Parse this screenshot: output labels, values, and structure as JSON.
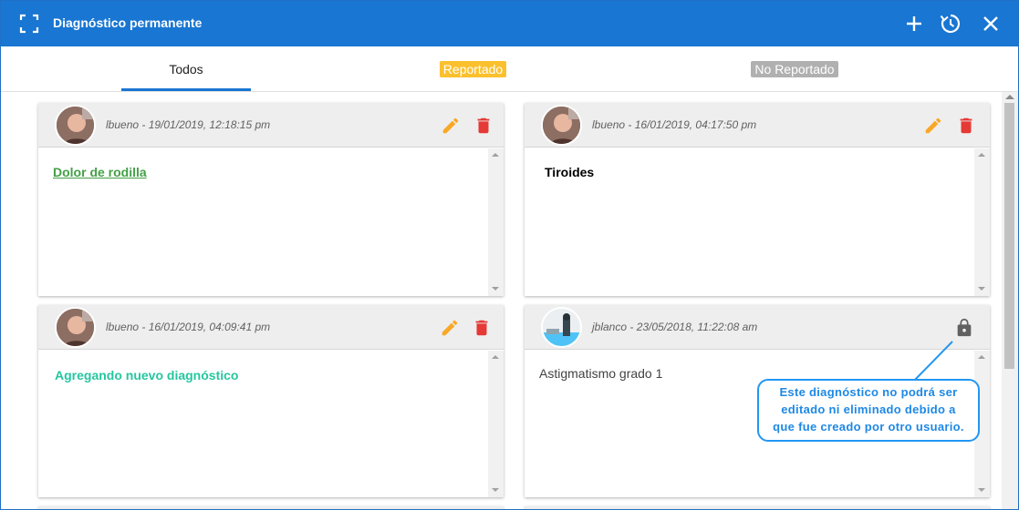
{
  "window": {
    "title": "Diagnóstico permanente",
    "accent": "#1976d2"
  },
  "toolbar": {
    "expand_icon": "expand-icon",
    "add_icon": "plus-icon",
    "history_icon": "history-icon",
    "close_icon": "close-icon"
  },
  "tabs": [
    {
      "label": "Todos",
      "active": true
    },
    {
      "label": "Reportado",
      "color": "#fbc02d"
    },
    {
      "label": "No Reportado",
      "color": "#b0b0b0"
    }
  ],
  "cards": [
    {
      "user": "lbueno",
      "meta": "lbueno - 19/01/2019, 12:18:15 pm",
      "diagnosis": "Dolor de rodilla",
      "color": "#43a047",
      "editable": true
    },
    {
      "user": "lbueno",
      "meta": "lbueno - 16/01/2019, 04:17:50 pm",
      "diagnosis": "Tiroides",
      "color": "#000000",
      "editable": true
    },
    {
      "user": "lbueno",
      "meta": "lbueno - 16/01/2019, 04:09:41 pm",
      "diagnosis": "Agregando nuevo diagnóstico",
      "color": "#26c6a0",
      "editable": true
    },
    {
      "user": "jblanco",
      "meta": "jblanco - 23/05/2018, 11:22:08 am",
      "diagnosis": "Astigmatismo grado 1",
      "color": "#424242",
      "editable": false
    }
  ],
  "callout": {
    "line1": "Este diagnóstico no podrá ser",
    "line2": "editado ni eliminado debido a",
    "line3": "que fue creado por otro usuario."
  }
}
